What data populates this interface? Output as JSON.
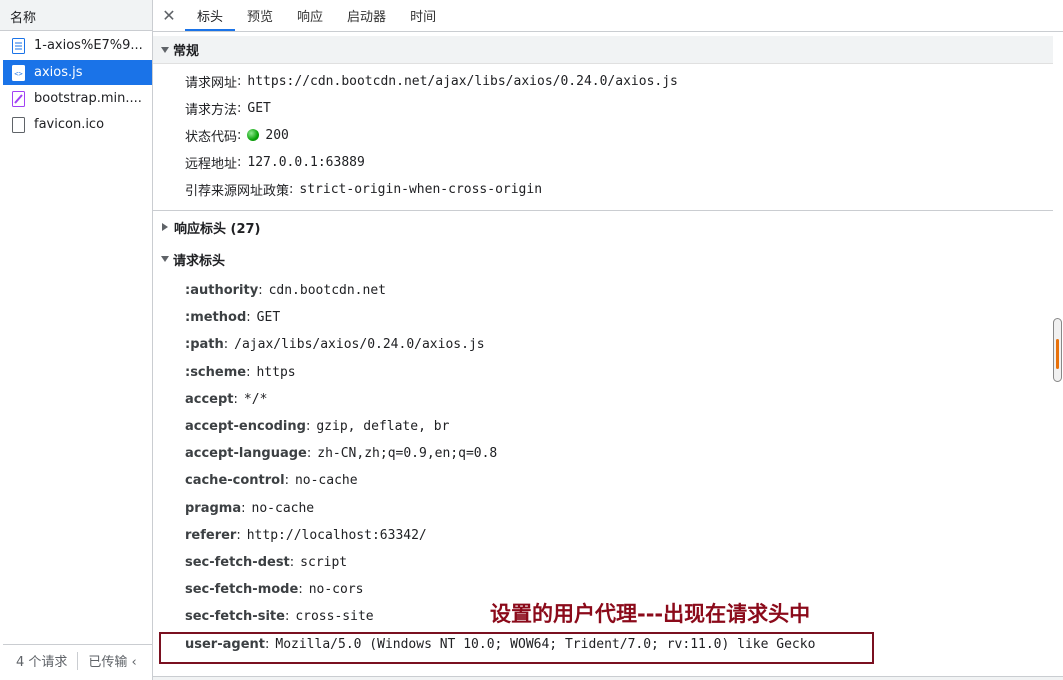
{
  "left_pane": {
    "header": "名称",
    "files": [
      {
        "name": "1-axios%E7%9...",
        "icon": "document-icon",
        "selected": false
      },
      {
        "name": "axios.js",
        "icon": "script-icon",
        "selected": true
      },
      {
        "name": "bootstrap.min....",
        "icon": "stylesheet-icon",
        "selected": false
      },
      {
        "name": "favicon.ico",
        "icon": "blank-file-icon",
        "selected": false
      }
    ],
    "status": {
      "requests": "4 个请求",
      "transferred": "已传输 ‹"
    }
  },
  "tabs": {
    "close": "✕",
    "items": [
      "标头",
      "预览",
      "响应",
      "启动器",
      "时间"
    ],
    "active": "标头"
  },
  "general": {
    "title": "常规",
    "rows": [
      {
        "key": "请求网址",
        "value": "https://cdn.bootcdn.net/ajax/libs/axios/0.24.0/axios.js"
      },
      {
        "key": "请求方法",
        "value": "GET"
      },
      {
        "key": "状态代码",
        "value": "200"
      },
      {
        "key": "远程地址",
        "value": "127.0.0.1:63889"
      },
      {
        "key": "引荐来源网址政策",
        "value": "strict-origin-when-cross-origin"
      }
    ]
  },
  "response_headers": {
    "title": "响应标头 (27)"
  },
  "request_headers": {
    "title": "请求标头",
    "rows": [
      {
        "key": ":authority",
        "value": "cdn.bootcdn.net"
      },
      {
        "key": ":method",
        "value": "GET"
      },
      {
        "key": ":path",
        "value": "/ajax/libs/axios/0.24.0/axios.js"
      },
      {
        "key": ":scheme",
        "value": "https"
      },
      {
        "key": "accept",
        "value": "*/*"
      },
      {
        "key": "accept-encoding",
        "value": "gzip, deflate, br"
      },
      {
        "key": "accept-language",
        "value": "zh-CN,zh;q=0.9,en;q=0.8"
      },
      {
        "key": "cache-control",
        "value": "no-cache"
      },
      {
        "key": "pragma",
        "value": "no-cache"
      },
      {
        "key": "referer",
        "value": "http://localhost:63342/"
      },
      {
        "key": "sec-fetch-dest",
        "value": "script"
      },
      {
        "key": "sec-fetch-mode",
        "value": "no-cors"
      },
      {
        "key": "sec-fetch-site",
        "value": "cross-site"
      },
      {
        "key": "user-agent",
        "value": "Mozilla/5.0 (Windows NT 10.0; WOW64; Trident/7.0; rv:11.0) like Gecko"
      }
    ]
  },
  "annotation": {
    "text": "设置的用户代理---出现在请求头中",
    "color": "#8b0a1a"
  },
  "colors": {
    "accent": "#1a73e8",
    "status_ok": "#0aa30a"
  }
}
